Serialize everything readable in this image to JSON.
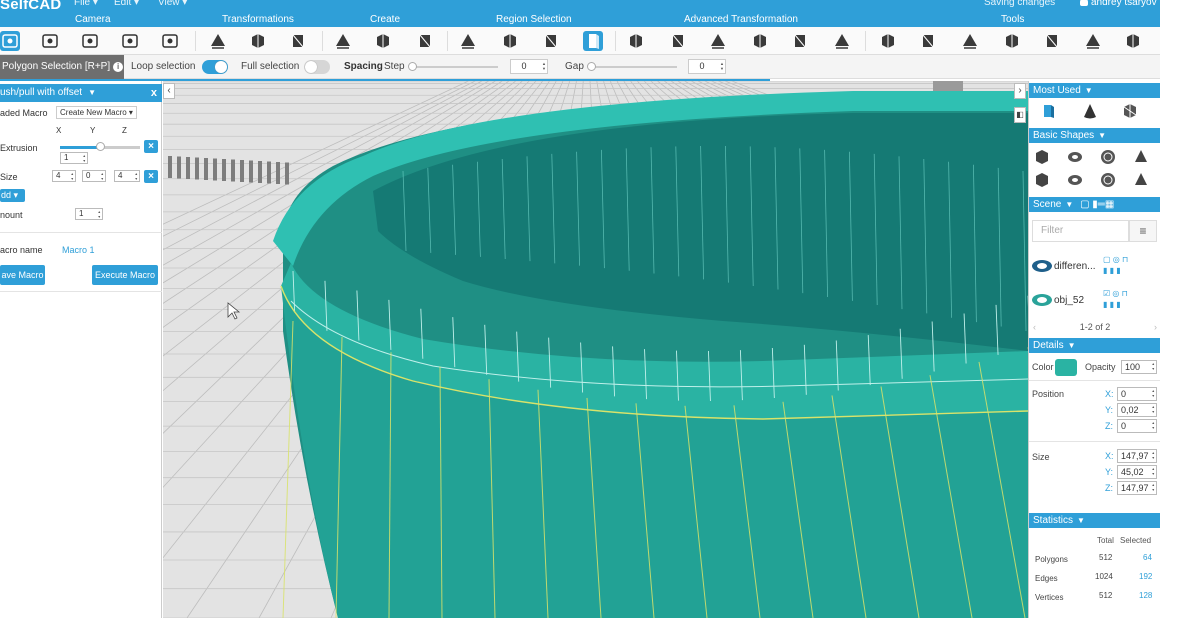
{
  "app": {
    "logo": "SelfCAD",
    "menus": [
      "File",
      "Edit",
      "View"
    ],
    "status": "Saving changes",
    "user": "andrey tsaryov"
  },
  "groups": [
    "Camera",
    "Transformations",
    "Create",
    "Region Selection",
    "Advanced Transformation",
    "Tools"
  ],
  "options": {
    "mode_label": "Polygon Selection [R+P]",
    "loop_selection_label": "Loop selection",
    "loop_selection_on": true,
    "full_selection_label": "Full selection",
    "full_selection_on": false,
    "spacing_label": "Spacing",
    "step_label": "Step",
    "step_value": "0",
    "gap_label": "Gap",
    "gap_value": "0"
  },
  "left_panel": {
    "title": "ush/pull with offset",
    "loaded_macro_label": "aded Macro",
    "loaded_macro_value": "Create New Macro",
    "axis_x": "X",
    "axis_y": "Y",
    "axis_z": "Z",
    "extrusion_label": "Extrusion",
    "extrusion_value": "1",
    "size_label": "Size",
    "size_x": "4",
    "size_y": "0",
    "size_z": "4",
    "add_label": "dd",
    "amount_label": "nount",
    "amount_value": "1",
    "macro_name_label": "acro name",
    "macro_name_value": "Macro 1",
    "save_macro_label": "ave Macro",
    "execute_macro_label": "Execute Macro"
  },
  "right_panel": {
    "most_used_title": "Most Used",
    "basic_shapes_title": "Basic Shapes",
    "scene_title": "Scene",
    "filter_placeholder": "Filter",
    "objects": [
      {
        "name": "differen..."
      },
      {
        "name": "obj_52"
      }
    ],
    "pager": "1-2 of 2",
    "details_title": "Details",
    "color_label": "Color",
    "color_value": "#2ab3a3",
    "opacity_label": "Opacity",
    "opacity_value": "100",
    "position_label": "Position",
    "position": {
      "x": "0",
      "y": "0,02",
      "z": "0"
    },
    "size_label": "Size",
    "size": {
      "x": "147,97",
      "y": "45,02",
      "z": "147,97"
    },
    "statistics_title": "Statistics",
    "stats_total_header": "Total",
    "stats_selected_header": "Selected",
    "stats": [
      {
        "label": "Polygons",
        "total": "512",
        "selected": "64"
      },
      {
        "label": "Edges",
        "total": "1024",
        "selected": "192"
      },
      {
        "label": "Vertices",
        "total": "512",
        "selected": "128"
      }
    ]
  },
  "colors": {
    "accent": "#2f9fd8",
    "mesh": "#2ab3a3",
    "mesh_dark": "#1f8f84",
    "selection_edge": "#d9e36a"
  }
}
